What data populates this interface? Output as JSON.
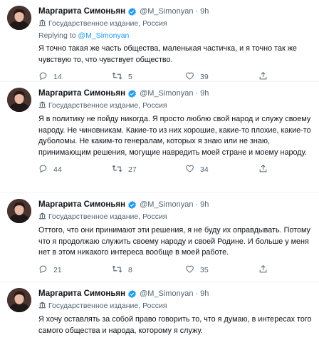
{
  "tweets": [
    {
      "name": "Маргарита Симоньян",
      "handle": "@M_Simonyan",
      "separator": "·",
      "time": "9h",
      "label": "Государственное издание, Россия",
      "reply_prefix": "Replying to ",
      "reply_to": "@M_Simonyan",
      "text": "Я точно такая же часть общества, маленькая частичка, и я точно так же чувствую то, что чувствует общество.",
      "replies": "14",
      "retweets": "5",
      "likes": "39"
    },
    {
      "name": "Маргарита Симоньян",
      "handle": "@M_Simonyan",
      "separator": "·",
      "time": "9h",
      "label": "Государственное издание, Россия",
      "text": "Я в политику не пойду никогда. Я просто люблю свой народ и служу своему народу. Не чиновникам. Какие-то из них хорошие, какие-то плохие, какие-то дуболомы. Не каким-то генералам, которых я знаю или не знаю, принимающим решения, могущие навредить моей стране и моему народу.",
      "replies": "44",
      "retweets": "27",
      "likes": "34"
    },
    {
      "name": "Маргарита Симоньян",
      "handle": "@M_Simonyan",
      "separator": "·",
      "time": "9h",
      "label": "Государственное издание, Россия",
      "text": "Оттого, что они принимают эти решения, я не буду их оправдывать. Потому что я продолжаю служить своему народу и своей Родине. И больше у меня нет в этом никакого интереса вообще в моей работе.",
      "replies": "21",
      "retweets": "8",
      "likes": "35"
    },
    {
      "name": "Маргарита Симоньян",
      "handle": "@M_Simonyan",
      "separator": "·",
      "time": "9h",
      "label": "Государственное издание, Россия",
      "text": "Я хочу оставлять за собой право говорить то, что я думаю, в интересах того самого общества и народа, которому я служу."
    }
  ],
  "colors": {
    "verified": "#1d9bf0",
    "mention": "#1d9bf0",
    "secondary_text": "#536471",
    "divider": "#eff3f4"
  },
  "icons": [
    "verified-badge-icon",
    "state-media-icon",
    "reply-icon",
    "retweet-icon",
    "like-icon",
    "share-icon"
  ]
}
